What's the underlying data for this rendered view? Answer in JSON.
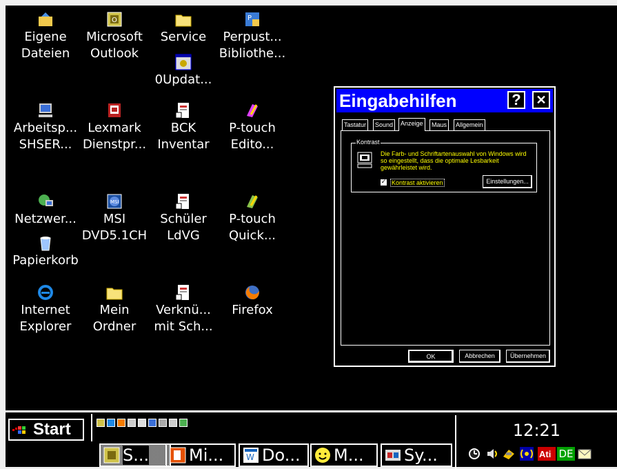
{
  "desktop": {
    "icons": [
      {
        "id": "eigene-dateien",
        "label": "Eigene\nDateien",
        "icon": "my-documents-icon"
      },
      {
        "id": "microsoft-outlook",
        "label": "Microsoft\nOutlook",
        "icon": "outlook-icon"
      },
      {
        "id": "service",
        "label": "Service",
        "icon": "folder-icon"
      },
      {
        "id": "perpustakaan",
        "label": "Perpust...\nBibliothe...",
        "icon": "library-app-icon"
      },
      {
        "id": "0updat",
        "label": "0Updat...",
        "icon": "update-shortcut-icon"
      },
      {
        "id": "arbeitsplatz",
        "label": "Arbeitsp...\nSHSER...",
        "icon": "my-computer-icon"
      },
      {
        "id": "lexmark",
        "label": "Lexmark\nDienstpr...",
        "icon": "lexmark-icon"
      },
      {
        "id": "bck-inventar",
        "label": "BCK\nInventar",
        "icon": "document-shortcut-icon"
      },
      {
        "id": "ptouch-editor",
        "label": "P-touch\nEdito...",
        "icon": "ptouch-icon"
      },
      {
        "id": "netzwerk",
        "label": "Netzwer...",
        "icon": "network-icon"
      },
      {
        "id": "msi-dvd",
        "label": "MSI\nDVD5.1CH",
        "icon": "msi-icon"
      },
      {
        "id": "schueler-ldvg",
        "label": "Schüler\nLdVG",
        "icon": "document-shortcut-icon"
      },
      {
        "id": "ptouch-quick",
        "label": "P-touch\nQuick...",
        "icon": "ptouch-quick-icon"
      },
      {
        "id": "papierkorb",
        "label": "Papierkorb",
        "icon": "recycle-bin-icon"
      },
      {
        "id": "internet-explorer",
        "label": "Internet\nExplorer",
        "icon": "internet-explorer-icon"
      },
      {
        "id": "mein-ordner",
        "label": "Mein\nOrdner",
        "icon": "folder-icon"
      },
      {
        "id": "verknuepfung",
        "label": "Verknü...\nmit Sch...",
        "icon": "document-shortcut-icon"
      },
      {
        "id": "firefox",
        "label": "Firefox",
        "icon": "firefox-icon"
      }
    ]
  },
  "dialog": {
    "title": "Eingabehilfen",
    "help_btn": "?",
    "close_btn": "✕",
    "tabs": [
      "Tastatur",
      "Sound",
      "Anzeige",
      "Maus",
      "Allgemein"
    ],
    "active_tab": "Anzeige",
    "group_title": "Kontrast",
    "group_desc": "Die Farb- und Schriftartenauswahl von Windows wird so eingestellt, dass die optimale Lesbarkeit gewährleistet wird.",
    "checkbox_label": "Kontrast aktivieren",
    "checkbox_checked": true,
    "settings_btn": "Einstellungen...",
    "ok_btn": "OK",
    "cancel_btn": "Abbrechen",
    "apply_btn": "Übernehmen"
  },
  "taskbar": {
    "start_label": "Start",
    "quick_launch": [
      "outlook-icon",
      "internet-explorer-icon",
      "firefox-icon",
      "app-icon",
      "app-icon",
      "computer-icon",
      "app-icon",
      "app-icon",
      "network-icon"
    ],
    "tasks": [
      {
        "label": "S...",
        "icon": "outlook-icon",
        "active": true
      },
      {
        "label": "Mi...",
        "icon": "powerpoint-icon",
        "active": false
      },
      {
        "label": "Do...",
        "icon": "word-icon",
        "active": false
      },
      {
        "label": "M...",
        "icon": "messenger-smiley-icon",
        "active": false
      },
      {
        "label": "Sy...",
        "icon": "control-panel-icon",
        "active": false
      }
    ],
    "clock": "12:21",
    "tray": [
      "clock-icon",
      "speaker-icon",
      "network-icon",
      "wireless-icon",
      "ati-icon",
      "DE",
      "mail-icon"
    ],
    "language": "DE"
  },
  "colors": {
    "desktop": "#000000",
    "title_bar": "#0000ff",
    "highlight_text": "#ffff00",
    "language_bg": "#00a000"
  }
}
